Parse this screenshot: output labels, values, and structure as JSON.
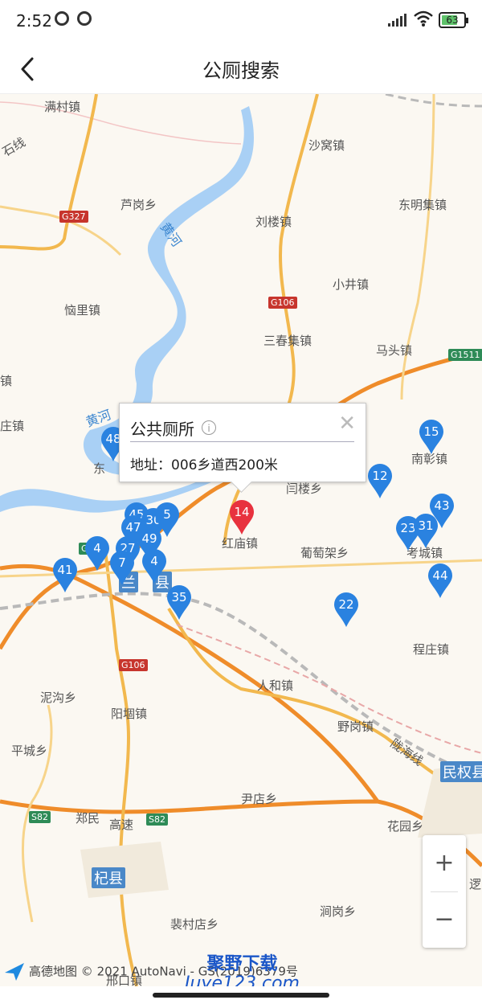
{
  "status_bar": {
    "time": "2:52",
    "battery": "63"
  },
  "header": {
    "title": "公厕搜索"
  },
  "map": {
    "places": {
      "mancun": "满村镇",
      "shiwo": "沙窝镇",
      "shixian": "石线",
      "lugang": "芦岗乡",
      "dongming": "东明集镇",
      "liulou": "刘楼镇",
      "xiaojing": "小井镇",
      "naoli": "恼里镇",
      "sanchunji": "三春集镇",
      "matou": "马头镇",
      "zhen_left": "镇",
      "zhuang": "庄镇",
      "nanzhang": "南彰镇",
      "donga": "东",
      "yanlou": "闫楼乡",
      "hongmiao": "红庙镇",
      "putaojia": "葡萄架乡",
      "kaocheng": "考城镇",
      "lan": "兰",
      "xian": "县",
      "chengzhuang": "程庄镇",
      "renhe": "人和镇",
      "nigou": "泥沟乡",
      "yanggu": "阳堌镇",
      "yegang": "野岗镇",
      "pingcheng": "平城乡",
      "longhai": "陇海线",
      "minquan": "民权县",
      "yindian": "尹店乡",
      "zhengmin": "郑民",
      "gaosu": "高速",
      "huayuan": "花园乡",
      "qixian": "杞县",
      "peicundian": "裴村店乡",
      "jiangang": "涧岗乡",
      "luo": "逻",
      "xizhen": "邢口镇"
    },
    "rivers": {
      "huanghe_a": "黄河",
      "huanghe_b": "黄河"
    },
    "shields": {
      "g327": "G327",
      "g106a": "G106",
      "g106b": "G106",
      "g1511": "G1511",
      "s82a": "S82",
      "s82b": "S82",
      "g_left": "G"
    },
    "pins": {
      "p48": "48",
      "p15": "15",
      "p12": "12",
      "p43": "43",
      "p23": "23",
      "p31": "31",
      "p44": "44",
      "p45": "45",
      "p30": "30",
      "p5": "5",
      "p47": "47",
      "p49": "49",
      "p4a": "4",
      "p27": "27",
      "p7": "7",
      "p4b": "4",
      "p41": "41",
      "p35": "35",
      "p22": "22",
      "p14": "14"
    }
  },
  "popup": {
    "name": "公共厕所",
    "info": "i",
    "close": "✕",
    "address": "地址：006乡道西200米"
  },
  "zoom": {
    "in": "+",
    "out": "−"
  },
  "attribution": {
    "brand": "高德地图",
    "text": "© 2021 AutoNavi - GS(2019)6379号"
  },
  "watermark": {
    "line1": "聚野下载",
    "line2": "Juye123.com"
  },
  "colors": {
    "pin_blue": "#2a82e0",
    "pin_red": "#e8323e",
    "road": "#f2b84e",
    "highway": "#ef8c2a",
    "water": "#a9d0f5"
  }
}
